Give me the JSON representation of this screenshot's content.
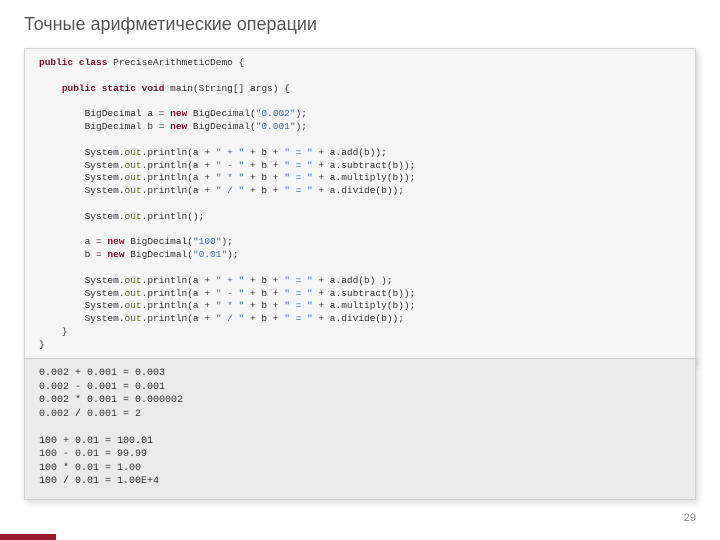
{
  "title": "Точные арифметические операции",
  "pagenum": "29",
  "code": {
    "l1_a": "public class",
    "l1_b": " PreciseArithmeticDemo {",
    "l2_a": "public static void",
    "l2_b": " main(String[] args) {",
    "l3_a": "        BigDecimal a = ",
    "l3_b": "new",
    "l3_c": " BigDecimal(",
    "l3_d": "\"0.002\"",
    "l3_e": ");",
    "l4_a": "        BigDecimal b = ",
    "l4_b": "new",
    "l4_c": " BigDecimal(",
    "l4_d": "\"0.001\"",
    "l4_e": ");",
    "l5_a": "        System.",
    "l5_b": "out",
    "l5_c": ".println(a + ",
    "l5_d": "\" + \"",
    "l5_e": " + b + ",
    "l5_f": "\" = \"",
    "l5_g": " + a.add(b));",
    "l6_a": "        System.",
    "l6_b": "out",
    "l6_c": ".println(a + ",
    "l6_d": "\" - \"",
    "l6_e": " + b + ",
    "l6_f": "\" = \"",
    "l6_g": " + a.subtract(b));",
    "l7_a": "        System.",
    "l7_b": "out",
    "l7_c": ".println(a + ",
    "l7_d": "\" * \"",
    "l7_e": " + b + ",
    "l7_f": "\" = \"",
    "l7_g": " + a.multiply(b));",
    "l8_a": "        System.",
    "l8_b": "out",
    "l8_c": ".println(a + ",
    "l8_d": "\" / \"",
    "l8_e": " + b + ",
    "l8_f": "\" = \"",
    "l8_g": " + a.divide(b));",
    "l9_a": "        System.",
    "l9_b": "out",
    "l9_c": ".println();",
    "l10_a": "        a = ",
    "l10_b": "new",
    "l10_c": " BigDecimal(",
    "l10_d": "\"100\"",
    "l10_e": ");",
    "l11_a": "        b = ",
    "l11_b": "new",
    "l11_c": " BigDecimal(",
    "l11_d": "\"0.01\"",
    "l11_e": ");",
    "l12_a": "        System.",
    "l12_b": "out",
    "l12_c": ".println(a + ",
    "l12_d": "\" + \"",
    "l12_e": " + b + ",
    "l12_f": "\" = \"",
    "l12_g": " + a.add(b) );",
    "l13_a": "        System.",
    "l13_b": "out",
    "l13_c": ".println(a + ",
    "l13_d": "\" - \"",
    "l13_e": " + b + ",
    "l13_f": "\" = \"",
    "l13_g": " + a.subtract(b));",
    "l14_a": "        System.",
    "l14_b": "out",
    "l14_c": ".println(a + ",
    "l14_d": "\" * \"",
    "l14_e": " + b + ",
    "l14_f": "\" = \"",
    "l14_g": " + a.multiply(b));",
    "l15_a": "        System.",
    "l15_b": "out",
    "l15_c": ".println(a + ",
    "l15_d": "\" / \"",
    "l15_e": " + b + ",
    "l15_f": "\" = \"",
    "l15_g": " + a.divide(b));",
    "l16": "    }",
    "l17": "}"
  },
  "output": {
    "o1": "0.002 + 0.001 = 0.003",
    "o2": "0.002 - 0.001 = 0.001",
    "o3": "0.002 * 0.001 = 0.000002",
    "o4": "0.002 / 0.001 = 2",
    "o5": "",
    "o6": "100 + 0.01 = 100.01",
    "o7": "100 - 0.01 = 99.99",
    "o8": "100 * 0.01 = 1.00",
    "o9": "100 / 0.01 = 1.00E+4"
  }
}
